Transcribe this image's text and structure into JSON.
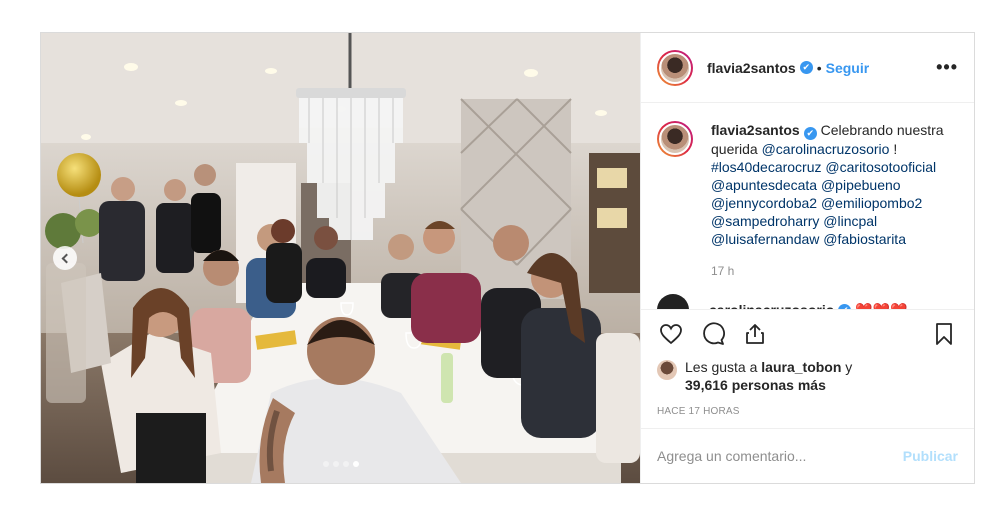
{
  "post": {
    "username": "flavia2santos",
    "verified_mark": "✔",
    "separator": "•",
    "follow_label": "Seguir",
    "more_label": "•••",
    "carousel": {
      "slide_count": 4,
      "active_slide": 4
    }
  },
  "caption": {
    "username": "flavia2santos",
    "intro": "Celebrando nuestra querida",
    "mention_1": "@carolinacruzosorio",
    "bang": "!",
    "hashtag": "#los40decarocruz",
    "mentions": [
      "@caritosotooficial",
      "@apuntesdecata",
      "@pipebueno",
      "@jennycordoba2",
      "@emiliopombo2",
      "@sampedroharry",
      "@lincpal",
      "@luisafernandaw",
      "@fabiostarita"
    ],
    "time": "17 h"
  },
  "next_comment": {
    "username": "carolinacruzosorio",
    "hearts": "❤️❤️❤️"
  },
  "icons": {
    "like": "heart-icon",
    "comment": "comment-icon",
    "share": "share-icon",
    "save": "bookmark-icon"
  },
  "likes": {
    "prefix": "Les gusta a",
    "user": "laura_tobon",
    "conj": "y",
    "count": "39,616 personas más"
  },
  "timestamp": "HACE 17 HORAS",
  "comment_box": {
    "placeholder": "Agrega un comentario...",
    "publish_label": "Publicar"
  },
  "colors": {
    "link": "#003569",
    "accent": "#3897f0",
    "publish_disabled": "#b2dffc",
    "heart": "#ed4956"
  }
}
